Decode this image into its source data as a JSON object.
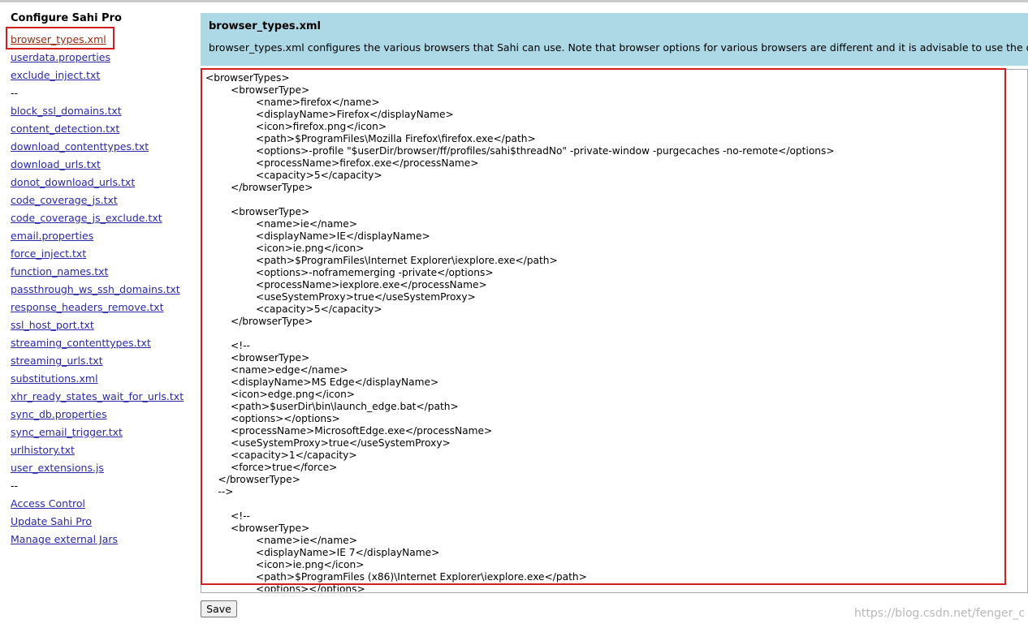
{
  "sidebar": {
    "title": "Configure Sahi Pro",
    "items": [
      {
        "label": "browser_types.xml",
        "type": "link",
        "selected": true
      },
      {
        "label": "userdata.properties",
        "type": "link"
      },
      {
        "label": "exclude_inject.txt",
        "type": "link"
      },
      {
        "label": "--",
        "type": "separator"
      },
      {
        "label": "block_ssl_domains.txt",
        "type": "link"
      },
      {
        "label": "content_detection.txt",
        "type": "link"
      },
      {
        "label": "download_contenttypes.txt",
        "type": "link"
      },
      {
        "label": "download_urls.txt",
        "type": "link"
      },
      {
        "label": "donot_download_urls.txt",
        "type": "link"
      },
      {
        "label": "code_coverage_js.txt",
        "type": "link"
      },
      {
        "label": "code_coverage_js_exclude.txt",
        "type": "link"
      },
      {
        "label": "email.properties",
        "type": "link"
      },
      {
        "label": "force_inject.txt",
        "type": "link"
      },
      {
        "label": "function_names.txt",
        "type": "link"
      },
      {
        "label": "passthrough_ws_ssh_domains.txt",
        "type": "link"
      },
      {
        "label": "response_headers_remove.txt",
        "type": "link"
      },
      {
        "label": "ssl_host_port.txt",
        "type": "link"
      },
      {
        "label": "streaming_contenttypes.txt",
        "type": "link"
      },
      {
        "label": "streaming_urls.txt",
        "type": "link"
      },
      {
        "label": "substitutions.xml",
        "type": "link"
      },
      {
        "label": "xhr_ready_states_wait_for_urls.txt",
        "type": "link"
      },
      {
        "label": "sync_db.properties",
        "type": "link"
      },
      {
        "label": "sync_email_trigger.txt",
        "type": "link"
      },
      {
        "label": "urlhistory.txt",
        "type": "link"
      },
      {
        "label": "user_extensions.js",
        "type": "link"
      },
      {
        "label": "--",
        "type": "separator"
      },
      {
        "label": "Access Control",
        "type": "link"
      },
      {
        "label": "Update Sahi Pro",
        "type": "link"
      },
      {
        "label": "Manage external Jars",
        "type": "link"
      }
    ]
  },
  "info": {
    "title": "browser_types.xml",
    "description": "browser_types.xml configures the various browsers that Sahi can use. Note that browser options for various browsers are different and it is advisable to use the defau"
  },
  "editor": {
    "content": "<browserTypes>\n        <browserType>\n                <name>firefox</name>\n                <displayName>Firefox</displayName>\n                <icon>firefox.png</icon>\n                <path>$ProgramFiles\\Mozilla Firefox\\firefox.exe</path>\n                <options>-profile \"$userDir/browser/ff/profiles/sahi$threadNo\" -private-window -purgecaches -no-remote</options>\n                <processName>firefox.exe</processName>\n                <capacity>5</capacity>\n        </browserType>\n\n        <browserType>\n                <name>ie</name>\n                <displayName>IE</displayName>\n                <icon>ie.png</icon>\n                <path>$ProgramFiles\\Internet Explorer\\iexplore.exe</path>\n                <options>-noframemerging -private</options>\n                <processName>iexplore.exe</processName>\n                <useSystemProxy>true</useSystemProxy>\n                <capacity>5</capacity>\n        </browserType>\n\n        <!--\n        <browserType>\n        <name>edge</name>\n        <displayName>MS Edge</displayName>\n        <icon>edge.png</icon>\n        <path>$userDir\\bin\\launch_edge.bat</path>\n        <options></options>\n        <processName>MicrosoftEdge.exe</processName>\n        <useSystemProxy>true</useSystemProxy>\n        <capacity>1</capacity>\n        <force>true</force>\n    </browserType>\n    -->\n\n        <!--\n        <browserType>\n                <name>ie</name>\n                <displayName>IE 7</displayName>\n                <icon>ie.png</icon>\n                <path>$ProgramFiles (x86)\\Internet Explorer\\iexplore.exe</path>\n                <options></options>"
  },
  "actions": {
    "save_label": "Save"
  },
  "watermark": "https://blog.csdn.net/fenger_c",
  "colors": {
    "link": "#2929a8",
    "link_selected": "#9a2b10",
    "info_background": "#add8e6",
    "highlight_border": "#d11f1f"
  }
}
